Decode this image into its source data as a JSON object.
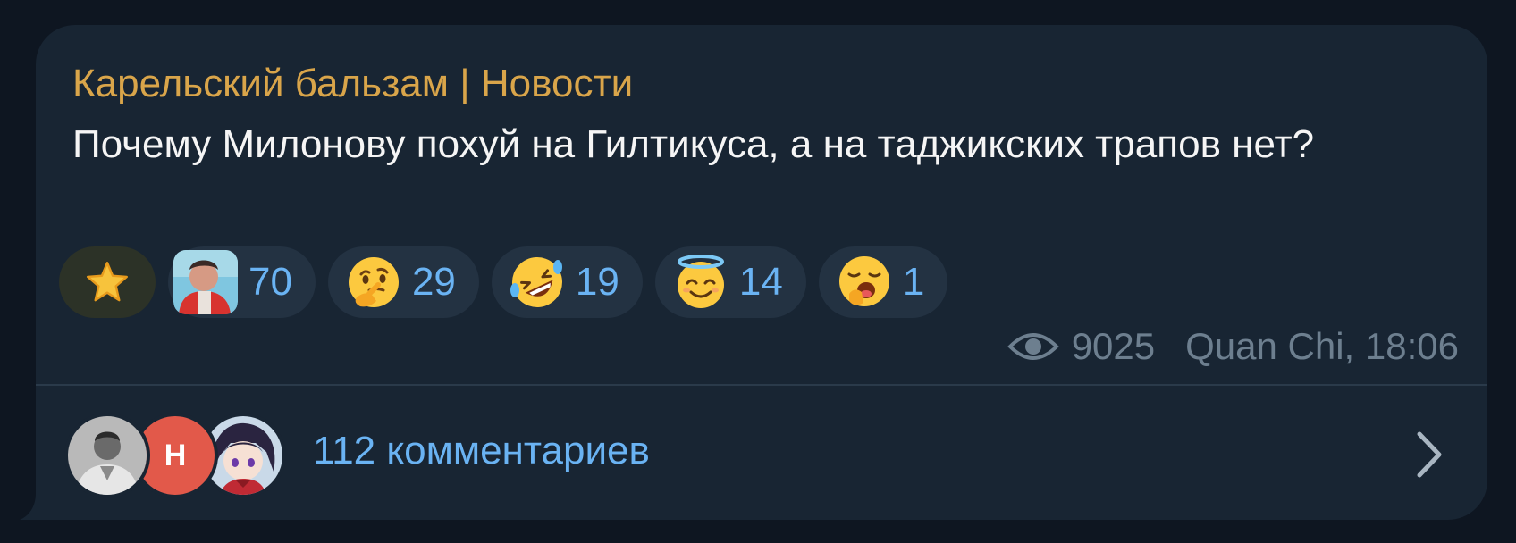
{
  "post": {
    "channel_name": "Карельский бальзам | Новости",
    "text": "Почему Милонову похуй на Гилтикуса, а на таджикских трапов нет?",
    "views": "9025",
    "author_time": "Quan Chi, 18:06"
  },
  "reactions": [
    {
      "icon": "star-icon",
      "count": ""
    },
    {
      "icon": "custom-avatar-reaction",
      "count": "70"
    },
    {
      "icon": "thinking-face-icon",
      "count": "29"
    },
    {
      "icon": "rolling-on-floor-laughing-icon",
      "count": "19"
    },
    {
      "icon": "smiling-face-with-halo-icon",
      "count": "14"
    },
    {
      "icon": "yawning-face-icon",
      "count": "1"
    }
  ],
  "comments": {
    "avatar_letter": "Н",
    "label": "112 комментариев"
  },
  "colors": {
    "background": "#0e1621",
    "bubble": "#182533",
    "channel_name": "#d9a54a",
    "accent": "#6ab3f3",
    "meta": "#6d7f8f"
  }
}
